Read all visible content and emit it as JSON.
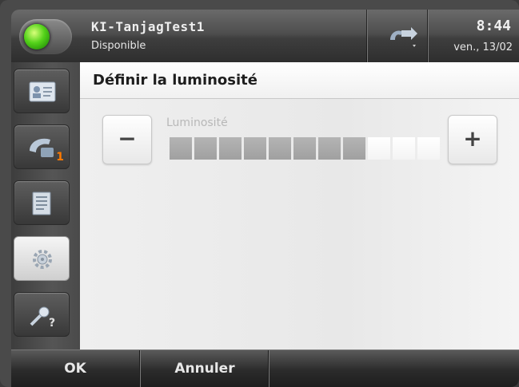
{
  "header": {
    "user_name": "KI-TanjagTest1",
    "presence_status": "Disponible",
    "clock_time": "8:44",
    "clock_date": "ven., 13/02",
    "presence_color": "#54d21a",
    "forward_icon": "call-forward-icon"
  },
  "sidebar": {
    "items": [
      {
        "name": "contacts",
        "icon": "contact-card-icon",
        "active": false,
        "badge": ""
      },
      {
        "name": "calls",
        "icon": "phone-handset-icon",
        "active": false,
        "badge": "1"
      },
      {
        "name": "directory",
        "icon": "address-book-icon",
        "active": false,
        "badge": ""
      },
      {
        "name": "settings",
        "icon": "gear-icon",
        "active": true,
        "badge": ""
      },
      {
        "name": "help",
        "icon": "help-key-icon",
        "active": false,
        "badge": ""
      }
    ]
  },
  "main": {
    "title": "Définir la luminosité",
    "brightness": {
      "label": "Luminosité",
      "decrease_label": "−",
      "increase_label": "+",
      "level": 8,
      "max": 11
    }
  },
  "softkeys": {
    "ok_label": "OK",
    "cancel_label": "Annuler"
  }
}
